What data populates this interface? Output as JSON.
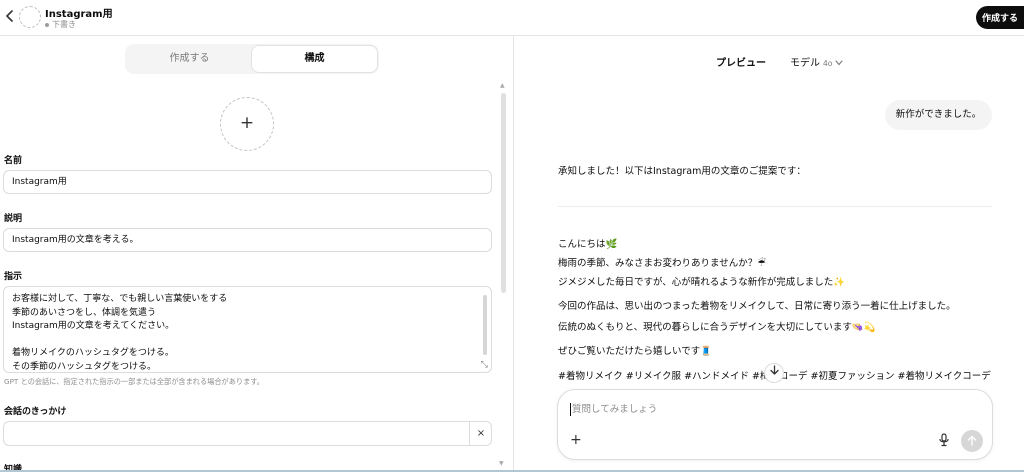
{
  "header": {
    "back_icon": "chevron-left-icon",
    "gpt_name": "Instagram用",
    "status": "下書き",
    "create_button": "作成する"
  },
  "tabs": [
    {
      "label": "作成する",
      "active": false
    },
    {
      "label": "構成",
      "active": true
    }
  ],
  "configure": {
    "avatar_plus": "+",
    "name_label": "名前",
    "name_value": "Instagram用",
    "description_label": "説明",
    "description_value": "Instagram用の文章を考える。",
    "instructions_label": "指示",
    "instructions_lines": [
      "お客様に対して、丁寧な、でも親しい言葉使いをする",
      "季節のあいさつをし、体調を気遣う",
      "Instagram用の文章を考えてください。",
      "",
      "着物リメイクのハッシュタグをつける。",
      "その季節のハッシュタグをつける。"
    ],
    "instructions_helper": "GPT との会話に、指定された指示の一部または全部が含まれる場合があります。",
    "starters_label": "会話のきっかけ",
    "starter_value": "",
    "starter_clear": "×",
    "knowledge_label": "知識"
  },
  "preview": {
    "title": "プレビュー",
    "model_label": "モデル",
    "model_version": "4o",
    "user_message": "新作ができました。",
    "assistant_intro": "承知しました！以下はInstagram用の文章のご提案です：",
    "assistant_lines": [
      "こんにちは🌿",
      "梅雨の季節、みなさまお変わりありませんか？☔",
      "ジメジメした毎日ですが、心が晴れるような新作が完成しました✨",
      "今回の作品は、思い出のつまった着物をリメイクして、日常に寄り添う一着に仕上げました。",
      "伝統のぬくもりと、現代の暮らしに合うデザインを大切にしています👒💫",
      "ぜひご覧いただけたら嬉しいです🧵"
    ],
    "hashtags": "#着物リメイク #リメイク服 #ハンドメイド #梅雨コーデ #初夏ファッション #着物リメイクコーデ",
    "composer_placeholder": "質問してみましょう",
    "composer_plus": "+",
    "send_icon": "arrow-up-icon",
    "mic_icon": "microphone-icon",
    "scroll_icon": "arrow-down-icon"
  },
  "colors": {
    "accent_dark": "#0d0d0d",
    "border": "#dcdcdc",
    "muted_text": "#8e8e8e",
    "bubble_bg": "#f4f4f4"
  }
}
